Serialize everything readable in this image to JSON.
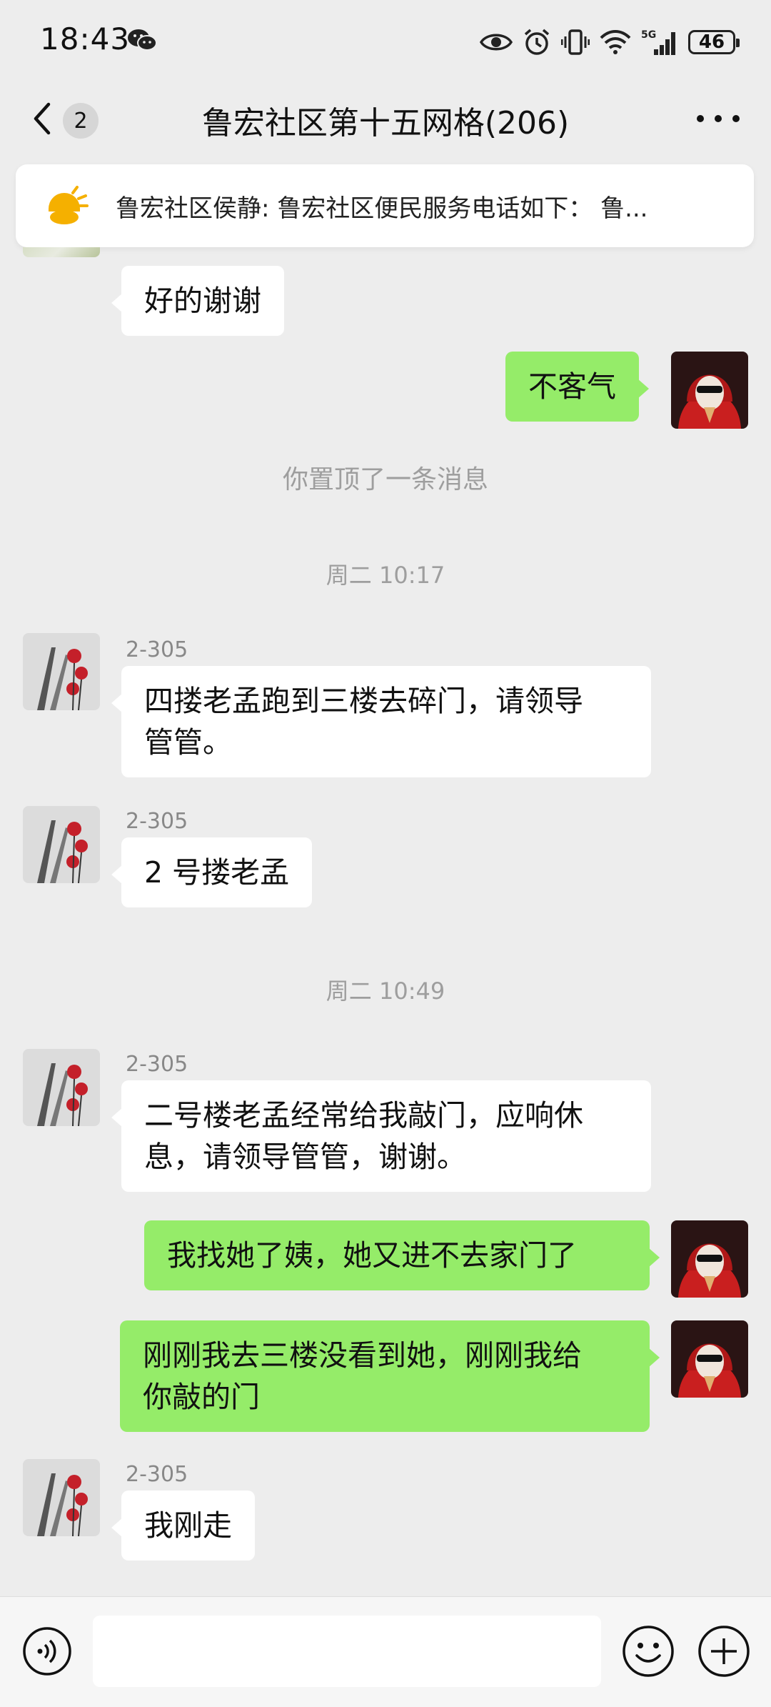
{
  "status_bar": {
    "time": "18:43",
    "battery": "46",
    "network": "5G"
  },
  "nav": {
    "unread_count": "2",
    "title": "鲁宏社区第十五网格(206)"
  },
  "pinned": {
    "text": "鲁宏社区侯静: 鲁宏社区便民服务电话如下： 鲁..."
  },
  "messages": {
    "m0": "好的谢谢",
    "m1": "不客气",
    "pin_note": "你置顶了一条消息",
    "time1": "周二 10:17",
    "sender1": "2-305",
    "m2_line1": "四搂老孟跑到三楼去碎门，请领导",
    "m2_line2": "管管。",
    "sender2": "2-305",
    "m3": "2 号搂老孟",
    "time2": "周二 10:49",
    "sender3": "2-305",
    "m4_line1": "二号楼老孟经常给我敲门，应响休",
    "m4_line2": "息，请领导管管，谢谢。",
    "m5": "我找她了姨，她又进不去家门了",
    "m6_line1": "刚刚我去三楼没看到她，刚刚我给",
    "m6_line2": "你敲的门",
    "sender4": "2-305",
    "m7": "我刚走"
  },
  "colors": {
    "background": "#ededed",
    "outgoing_bubble": "#95ec69",
    "incoming_bubble": "#ffffff",
    "pin_icon": "#f5b000"
  },
  "icons": [
    "wechat-icon",
    "eye-icon",
    "alarm-icon",
    "vibrate-icon",
    "wifi-icon",
    "signal-icon",
    "battery-icon",
    "back-arrow-icon",
    "more-icon",
    "pin-speaker-icon",
    "voice-icon",
    "emoji-icon",
    "plus-icon"
  ]
}
